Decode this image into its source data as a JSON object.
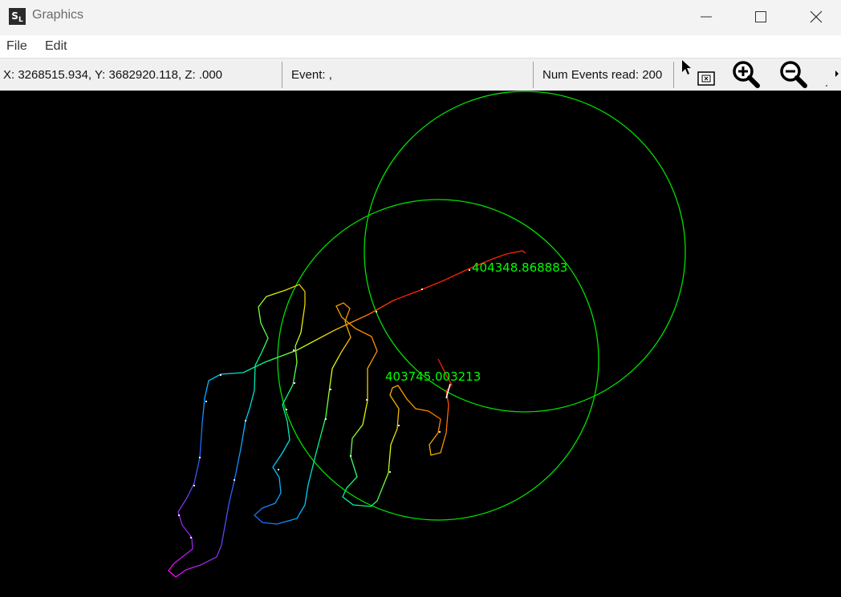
{
  "window": {
    "title": "Graphics",
    "icon": "SL",
    "icon_sub": ""
  },
  "menu": {
    "items": [
      "File",
      "Edit"
    ]
  },
  "status": {
    "coords": "X: 3268515.934, Y: 3682920.118, Z: .000",
    "event": "Event: ,",
    "num_events": "Num Events read: 200"
  },
  "toolbar": {
    "icons": [
      "select-cursor-icon",
      "zoom-in-icon",
      "zoom-out-icon",
      "overflow-arrow-icon"
    ]
  },
  "plot": {
    "labels": [
      "404348.868883",
      "403745.003213"
    ],
    "circle_color": "#00e000",
    "label_color": "#00ff00"
  }
}
